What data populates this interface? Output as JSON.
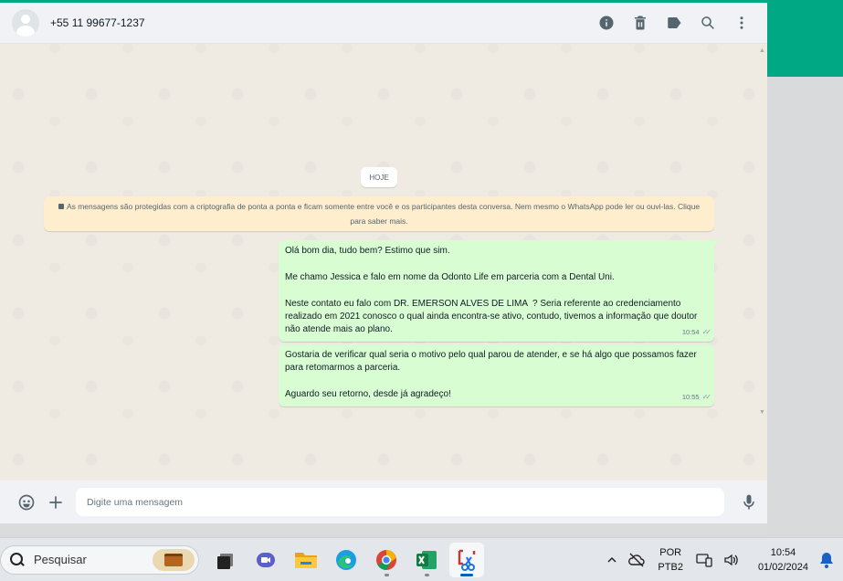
{
  "header": {
    "contact": "+55 11 99677-1237",
    "icons": [
      "info-icon",
      "delete-icon",
      "label-icon",
      "search-icon",
      "menu-icon"
    ]
  },
  "chat": {
    "date_chip": "HOJE",
    "encryption_notice": "As mensagens são protegidas com a criptografia de ponta a ponta e ficam somente entre você e os participantes desta conversa. Nem mesmo o WhatsApp pode ler ou ouvi-las. Clique para saber mais.",
    "messages": [
      {
        "text": "Olá bom dia, tudo bem? Estimo que sim.\n\nMe chamo Jessica e falo em nome da Odonto Life em parceria com a Dental Uni.\n\nNeste contato eu falo com DR. EMERSON ALVES DE LIMA  ? Seria referente ao credenciamento realizado em 2021 conosco o qual ainda encontra-se ativo, contudo, tivemos a informação que doutor não atende mais ao plano.",
        "time": "10:54",
        "status": "read"
      },
      {
        "text": "Gostaria de verificar qual seria o motivo pelo qual parou de atender, e se há algo que possamos fazer para retomarmos a parceria.\n\nAguardo seu retorno, desde já agradeço!",
        "time": "10:55",
        "status": "read"
      }
    ]
  },
  "composer": {
    "placeholder": "Digite uma mensagem"
  },
  "taskbar": {
    "search_label": "Pesquisar",
    "apps": [
      "task-view",
      "teams",
      "file-explorer",
      "edge",
      "chrome",
      "excel",
      "snipping-tool"
    ],
    "language_top": "POR",
    "language_bottom": "PTB2",
    "time": "10:54",
    "date": "01/02/2024"
  },
  "colors": {
    "accent": "#00a884",
    "bubble_out": "#d9fdd3",
    "chat_bg": "#efeae2",
    "notice_bg": "#ffeecd"
  }
}
